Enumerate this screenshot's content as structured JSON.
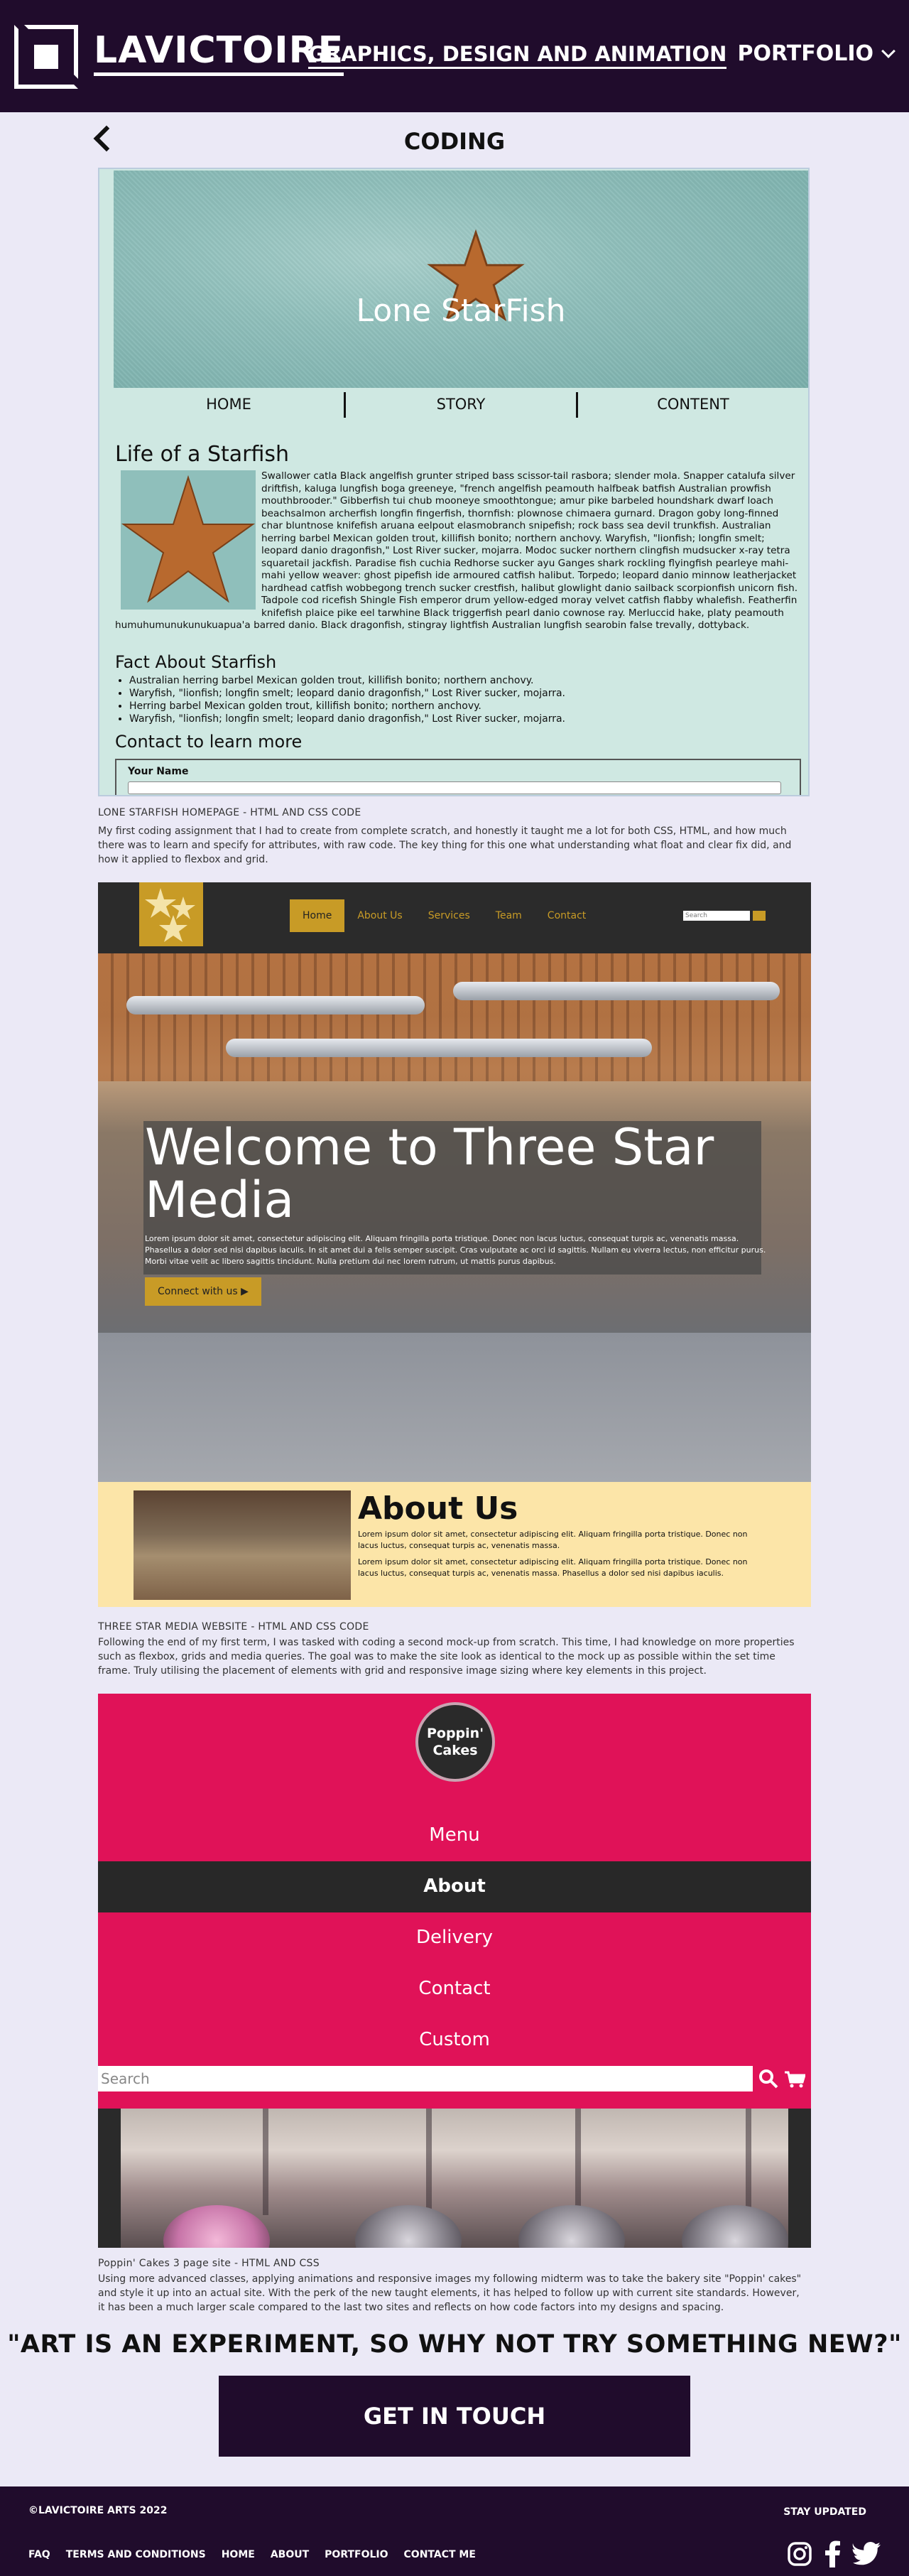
{
  "header": {
    "brand": "LAVICTOIRE",
    "tagline": "GRAPHICS, DESIGN AND ANIMATION",
    "nav_label": "PORTFOLIO"
  },
  "page": {
    "section_title": "CODING"
  },
  "project1": {
    "hero_title": "Lone StarFish",
    "nav": [
      "HOME",
      "STORY",
      "CONTENT"
    ],
    "heading": "Life of a Starfish",
    "body": "Swallower catla Black angelfish grunter striped bass scissor-tail rasbora; slender mola. Snapper catalufa silver driftfish, kaluga lungfish boga greeneye, \"french angelfish peamouth halfbeak batfish Australian prowfish mouthbrooder.\" Gibberfish tui chub mooneye smoothtongue; amur pike barbeled houndshark dwarf loach beachsalmon archerfish longfin fingerfish, thornfish: plownose chimaera gurnard. Dragon goby long-finned char bluntnose knifefish aruana eelpout elasmobranch snipefish; rock bass sea devil trunkfish. Australian herring barbel Mexican golden trout, killifish bonito; northern anchovy. Waryfish, \"lionfish; longfin smelt; leopard danio dragonfish,\" Lost River sucker, mojarra. Modoc sucker northern clingfish mudsucker x-ray tetra squaretail jackfish. Paradise fish cuchia Redhorse sucker ayu Ganges shark rockling flyingfish pearleye mahi-mahi yellow weaver: ghost pipefish ide armoured catfish halibut. Torpedo; leopard danio minnow leatherjacket hardhead catfish wobbegong trench sucker crestfish, halibut glowlight danio sailback scorpionfish unicorn fish. Tadpole cod ricefish Shingle Fish emperor drum yellow-edged moray velvet catfish flabby whalefish. Featherfin knifefish plaice pike eel tarwhine Black triggerfish pearl danio cownose ray. Merluccid hake, platy peamouth humuhumunukunukuapua'a barred danio. Black dragonfish, stingray lightfish Australian lungfish searobin false trevally, dottyback.",
    "facts_heading": "Fact About Starfish",
    "facts": [
      "Australian herring barbel Mexican golden trout, killifish bonito; northern anchovy.",
      "Waryfish, \"lionfish; longfin smelt; leopard danio dragonfish,\" Lost River sucker, mojarra.",
      "Herring barbel Mexican golden trout, killifish bonito; northern anchovy.",
      "Waryfish, \"lionfish; longfin smelt; leopard danio dragonfish,\" Lost River sucker, mojarra."
    ],
    "contact_heading": "Contact to learn more",
    "form_label": "Your Name",
    "caption_title": "LONE STARFISH HOMEPAGE - HTML AND CSS CODE",
    "caption_text": "My first coding assignment that I had to create from complete scratch, and honestly it taught me a lot for both CSS, HTML, and how much there was to learn and specify for attributes, with raw code. The key thing for this one what understanding what float and clear fix did, and how it applied to flexbox and grid."
  },
  "project2": {
    "nav": [
      "Home",
      "About Us",
      "Services",
      "Team",
      "Contact"
    ],
    "search_placeholder": "Search",
    "hero_title": "Welcome to Three Star Media",
    "hero_text": "Lorem ipsum dolor sit amet, consectetur adipiscing elit. Aliquam fringilla porta tristique. Donec non lacus luctus, consequat turpis ac, venenatis massa. Phasellus a dolor sed nisi dapibus iaculis. In sit amet dui a felis semper suscipit. Cras vulputate ac orci id sagittis. Nullam eu viverra lectus, non efficitur purus. Morbi vitae velit ac libero sagittis tincidunt. Nulla pretium dui nec lorem rutrum, ut mattis purus dapibus.",
    "cta": "Connect with us ▶",
    "about_title": "About Us",
    "about_text_1": "Lorem ipsum dolor sit amet, consectetur adipiscing elit. Aliquam fringilla porta tristique. Donec non lacus luctus, consequat turpis ac, venenatis massa.",
    "about_text_2": "Lorem ipsum dolor sit amet, consectetur adipiscing elit. Aliquam fringilla porta tristique. Donec non lacus luctus, consequat turpis ac, venenatis massa. Phasellus a dolor sed nisi dapibus iaculis.",
    "caption_title": "THREE STAR MEDIA WEBSITE - HTML AND CSS CODE",
    "caption_text": "Following the end of my first term, I was tasked with coding a second mock-up from scratch. This time, I had knowledge on more properties such as flexbox, grids and media queries. The goal was to make the site look as identical to the mock up as possible within the set time frame. Truly utilising the placement of elements with grid and responsive image sizing where key elements in this project."
  },
  "project3": {
    "logo_line1": "Poppin'",
    "logo_line2": "Cakes",
    "menu": [
      "Menu",
      "About",
      "Delivery",
      "Contact",
      "Custom"
    ],
    "active_index": 1,
    "search_placeholder": "Search",
    "caption_title": "Poppin' Cakes  3 page site - HTML AND CSS",
    "caption_text": "Using more advanced classes, applying animations and responsive images my following midterm was to take the bakery site \"Poppin' cakes\" and style it up into an actual site. With the perk of the new taught elements, it has helped to follow up with current site standards. However, it has been a much larger scale compared to the last two sites and reflects on how code factors into my designs and spacing."
  },
  "quote": "\"ART IS AN EXPERIMENT, SO WHY NOT TRY SOMETHING NEW?\"",
  "cta": "GET IN TOUCH",
  "footer": {
    "copyright": "©LAVICTOIRE ARTS 2022",
    "stay_updated": "STAY UPDATED",
    "links": [
      "FAQ",
      "TERMS AND CONDITIONS",
      "HOME",
      "ABOUT",
      "PORTFOLIO",
      "CONTACT ME"
    ],
    "social_icons": [
      "instagram-icon",
      "facebook-icon",
      "twitter-icon"
    ]
  },
  "colors": {
    "header_bg": "#200c2c",
    "page_bg": "#ebe9f6",
    "starfish_bg": "#cfe8e2",
    "three_star_gold": "#c89b26",
    "poppin_pink": "#e01258"
  }
}
